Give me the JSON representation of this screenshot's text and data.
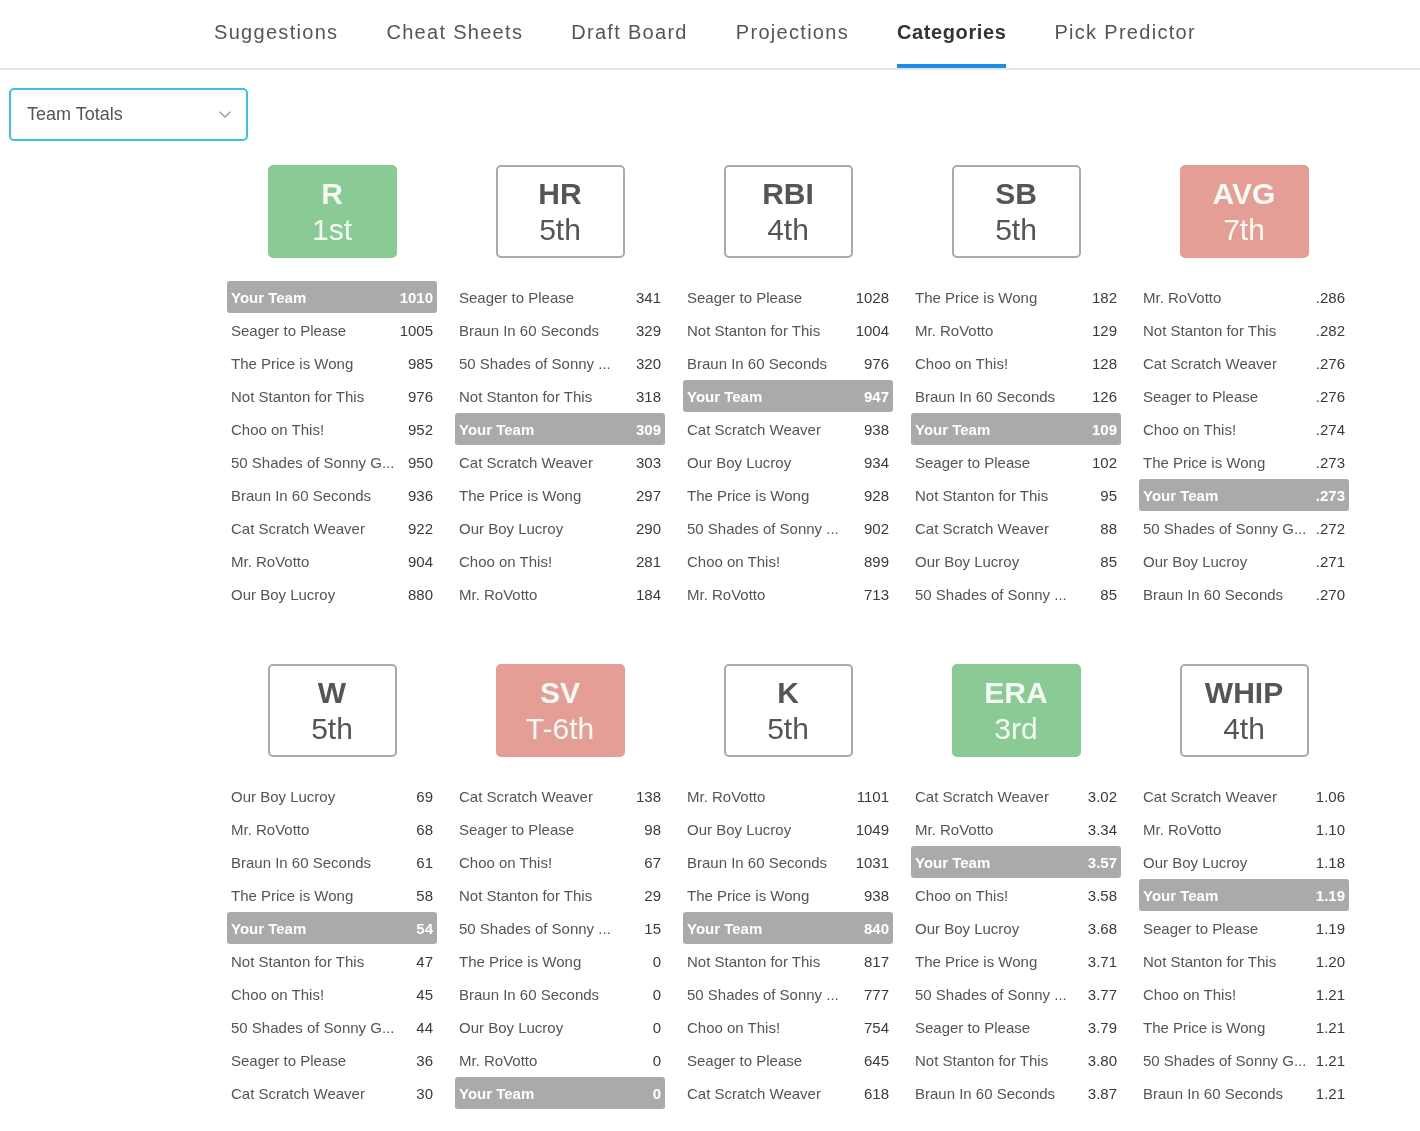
{
  "tabs": [
    {
      "label": "Suggestions",
      "selected": false
    },
    {
      "label": "Cheat Sheets",
      "selected": false
    },
    {
      "label": "Draft Board",
      "selected": false
    },
    {
      "label": "Projections",
      "selected": false
    },
    {
      "label": "Categories",
      "selected": true
    },
    {
      "label": "Pick Predictor",
      "selected": false
    }
  ],
  "view_select": {
    "value": "Team Totals"
  },
  "categories": [
    {
      "name": "R",
      "rank": "1st",
      "kind": "filled",
      "color": "#8aca94",
      "rows": [
        {
          "team": "Your Team",
          "value": "1010",
          "highlighted": true
        },
        {
          "team": "Seager to Please",
          "value": "1005",
          "highlighted": false
        },
        {
          "team": "The Price is Wong",
          "value": "985",
          "highlighted": false
        },
        {
          "team": "Not Stanton for This",
          "value": "976",
          "highlighted": false
        },
        {
          "team": "Choo on This!",
          "value": "952",
          "highlighted": false
        },
        {
          "team": "50 Shades of Sonny G...",
          "value": "950",
          "highlighted": false
        },
        {
          "team": "Braun In 60 Seconds",
          "value": "936",
          "highlighted": false
        },
        {
          "team": "Cat Scratch Weaver",
          "value": "922",
          "highlighted": false
        },
        {
          "team": "Mr. RoVotto",
          "value": "904",
          "highlighted": false
        },
        {
          "team": "Our Boy Lucroy",
          "value": "880",
          "highlighted": false
        }
      ]
    },
    {
      "name": "HR",
      "rank": "5th",
      "kind": "outlined",
      "rows": [
        {
          "team": "Seager to Please",
          "value": "341",
          "highlighted": false
        },
        {
          "team": "Braun In 60 Seconds",
          "value": "329",
          "highlighted": false
        },
        {
          "team": "50 Shades of Sonny ...",
          "value": "320",
          "highlighted": false
        },
        {
          "team": "Not Stanton for This",
          "value": "318",
          "highlighted": false
        },
        {
          "team": "Your Team",
          "value": "309",
          "highlighted": true
        },
        {
          "team": "Cat Scratch Weaver",
          "value": "303",
          "highlighted": false
        },
        {
          "team": "The Price is Wong",
          "value": "297",
          "highlighted": false
        },
        {
          "team": "Our Boy Lucroy",
          "value": "290",
          "highlighted": false
        },
        {
          "team": "Choo on This!",
          "value": "281",
          "highlighted": false
        },
        {
          "team": "Mr. RoVotto",
          "value": "184",
          "highlighted": false
        }
      ]
    },
    {
      "name": "RBI",
      "rank": "4th",
      "kind": "outlined",
      "rows": [
        {
          "team": "Seager to Please",
          "value": "1028",
          "highlighted": false
        },
        {
          "team": "Not Stanton for This",
          "value": "1004",
          "highlighted": false
        },
        {
          "team": "Braun In 60 Seconds",
          "value": "976",
          "highlighted": false
        },
        {
          "team": "Your Team",
          "value": "947",
          "highlighted": true
        },
        {
          "team": "Cat Scratch Weaver",
          "value": "938",
          "highlighted": false
        },
        {
          "team": "Our Boy Lucroy",
          "value": "934",
          "highlighted": false
        },
        {
          "team": "The Price is Wong",
          "value": "928",
          "highlighted": false
        },
        {
          "team": "50 Shades of Sonny ...",
          "value": "902",
          "highlighted": false
        },
        {
          "team": "Choo on This!",
          "value": "899",
          "highlighted": false
        },
        {
          "team": "Mr. RoVotto",
          "value": "713",
          "highlighted": false
        }
      ]
    },
    {
      "name": "SB",
      "rank": "5th",
      "kind": "outlined",
      "rows": [
        {
          "team": "The Price is Wong",
          "value": "182",
          "highlighted": false
        },
        {
          "team": "Mr. RoVotto",
          "value": "129",
          "highlighted": false
        },
        {
          "team": "Choo on This!",
          "value": "128",
          "highlighted": false
        },
        {
          "team": "Braun In 60 Seconds",
          "value": "126",
          "highlighted": false
        },
        {
          "team": "Your Team",
          "value": "109",
          "highlighted": true
        },
        {
          "team": "Seager to Please",
          "value": "102",
          "highlighted": false
        },
        {
          "team": "Not Stanton for This",
          "value": "95",
          "highlighted": false
        },
        {
          "team": "Cat Scratch Weaver",
          "value": "88",
          "highlighted": false
        },
        {
          "team": "Our Boy Lucroy",
          "value": "85",
          "highlighted": false
        },
        {
          "team": "50 Shades of Sonny ...",
          "value": "85",
          "highlighted": false
        }
      ]
    },
    {
      "name": "AVG",
      "rank": "7th",
      "kind": "filled",
      "color": "#e49e96",
      "rows": [
        {
          "team": "Mr. RoVotto",
          "value": ".286",
          "highlighted": false
        },
        {
          "team": "Not Stanton for This",
          "value": ".282",
          "highlighted": false
        },
        {
          "team": "Cat Scratch Weaver",
          "value": ".276",
          "highlighted": false
        },
        {
          "team": "Seager to Please",
          "value": ".276",
          "highlighted": false
        },
        {
          "team": "Choo on This!",
          "value": ".274",
          "highlighted": false
        },
        {
          "team": "The Price is Wong",
          "value": ".273",
          "highlighted": false
        },
        {
          "team": "Your Team",
          "value": ".273",
          "highlighted": true
        },
        {
          "team": "50 Shades of Sonny G...",
          "value": ".272",
          "highlighted": false
        },
        {
          "team": "Our Boy Lucroy",
          "value": ".271",
          "highlighted": false
        },
        {
          "team": "Braun In 60 Seconds",
          "value": ".270",
          "highlighted": false
        }
      ]
    },
    {
      "name": "W",
      "rank": "5th",
      "kind": "outlined",
      "rows": [
        {
          "team": "Our Boy Lucroy",
          "value": "69",
          "highlighted": false
        },
        {
          "team": "Mr. RoVotto",
          "value": "68",
          "highlighted": false
        },
        {
          "team": "Braun In 60 Seconds",
          "value": "61",
          "highlighted": false
        },
        {
          "team": "The Price is Wong",
          "value": "58",
          "highlighted": false
        },
        {
          "team": "Your Team",
          "value": "54",
          "highlighted": true
        },
        {
          "team": "Not Stanton for This",
          "value": "47",
          "highlighted": false
        },
        {
          "team": "Choo on This!",
          "value": "45",
          "highlighted": false
        },
        {
          "team": "50 Shades of Sonny G...",
          "value": "44",
          "highlighted": false
        },
        {
          "team": "Seager to Please",
          "value": "36",
          "highlighted": false
        },
        {
          "team": "Cat Scratch Weaver",
          "value": "30",
          "highlighted": false
        }
      ]
    },
    {
      "name": "SV",
      "rank": "T-6th",
      "kind": "filled",
      "color": "#e49e96",
      "rows": [
        {
          "team": "Cat Scratch Weaver",
          "value": "138",
          "highlighted": false
        },
        {
          "team": "Seager to Please",
          "value": "98",
          "highlighted": false
        },
        {
          "team": "Choo on This!",
          "value": "67",
          "highlighted": false
        },
        {
          "team": "Not Stanton for This",
          "value": "29",
          "highlighted": false
        },
        {
          "team": "50 Shades of Sonny ...",
          "value": "15",
          "highlighted": false
        },
        {
          "team": "The Price is Wong",
          "value": "0",
          "highlighted": false
        },
        {
          "team": "Braun In 60 Seconds",
          "value": "0",
          "highlighted": false
        },
        {
          "team": "Our Boy Lucroy",
          "value": "0",
          "highlighted": false
        },
        {
          "team": "Mr. RoVotto",
          "value": "0",
          "highlighted": false
        },
        {
          "team": "Your Team",
          "value": "0",
          "highlighted": true
        }
      ]
    },
    {
      "name": "K",
      "rank": "5th",
      "kind": "outlined",
      "rows": [
        {
          "team": "Mr. RoVotto",
          "value": "1101",
          "highlighted": false
        },
        {
          "team": "Our Boy Lucroy",
          "value": "1049",
          "highlighted": false
        },
        {
          "team": "Braun In 60 Seconds",
          "value": "1031",
          "highlighted": false
        },
        {
          "team": "The Price is Wong",
          "value": "938",
          "highlighted": false
        },
        {
          "team": "Your Team",
          "value": "840",
          "highlighted": true
        },
        {
          "team": "Not Stanton for This",
          "value": "817",
          "highlighted": false
        },
        {
          "team": "50 Shades of Sonny ...",
          "value": "777",
          "highlighted": false
        },
        {
          "team": "Choo on This!",
          "value": "754",
          "highlighted": false
        },
        {
          "team": "Seager to Please",
          "value": "645",
          "highlighted": false
        },
        {
          "team": "Cat Scratch Weaver",
          "value": "618",
          "highlighted": false
        }
      ]
    },
    {
      "name": "ERA",
      "rank": "3rd",
      "kind": "filled",
      "color": "#8aca94",
      "rows": [
        {
          "team": "Cat Scratch Weaver",
          "value": "3.02",
          "highlighted": false
        },
        {
          "team": "Mr. RoVotto",
          "value": "3.34",
          "highlighted": false
        },
        {
          "team": "Your Team",
          "value": "3.57",
          "highlighted": true
        },
        {
          "team": "Choo on This!",
          "value": "3.58",
          "highlighted": false
        },
        {
          "team": "Our Boy Lucroy",
          "value": "3.68",
          "highlighted": false
        },
        {
          "team": "The Price is Wong",
          "value": "3.71",
          "highlighted": false
        },
        {
          "team": "50 Shades of Sonny ...",
          "value": "3.77",
          "highlighted": false
        },
        {
          "team": "Seager to Please",
          "value": "3.79",
          "highlighted": false
        },
        {
          "team": "Not Stanton for This",
          "value": "3.80",
          "highlighted": false
        },
        {
          "team": "Braun In 60 Seconds",
          "value": "3.87",
          "highlighted": false
        }
      ]
    },
    {
      "name": "WHIP",
      "rank": "4th",
      "kind": "outlined",
      "rows": [
        {
          "team": "Cat Scratch Weaver",
          "value": "1.06",
          "highlighted": false
        },
        {
          "team": "Mr. RoVotto",
          "value": "1.10",
          "highlighted": false
        },
        {
          "team": "Our Boy Lucroy",
          "value": "1.18",
          "highlighted": false
        },
        {
          "team": "Your Team",
          "value": "1.19",
          "highlighted": true
        },
        {
          "team": "Seager to Please",
          "value": "1.19",
          "highlighted": false
        },
        {
          "team": "Not Stanton for This",
          "value": "1.20",
          "highlighted": false
        },
        {
          "team": "Choo on This!",
          "value": "1.21",
          "highlighted": false
        },
        {
          "team": "The Price is Wong",
          "value": "1.21",
          "highlighted": false
        },
        {
          "team": "50 Shades of Sonny G...",
          "value": "1.21",
          "highlighted": false
        },
        {
          "team": "Braun In 60 Seconds",
          "value": "1.21",
          "highlighted": false
        }
      ]
    }
  ]
}
